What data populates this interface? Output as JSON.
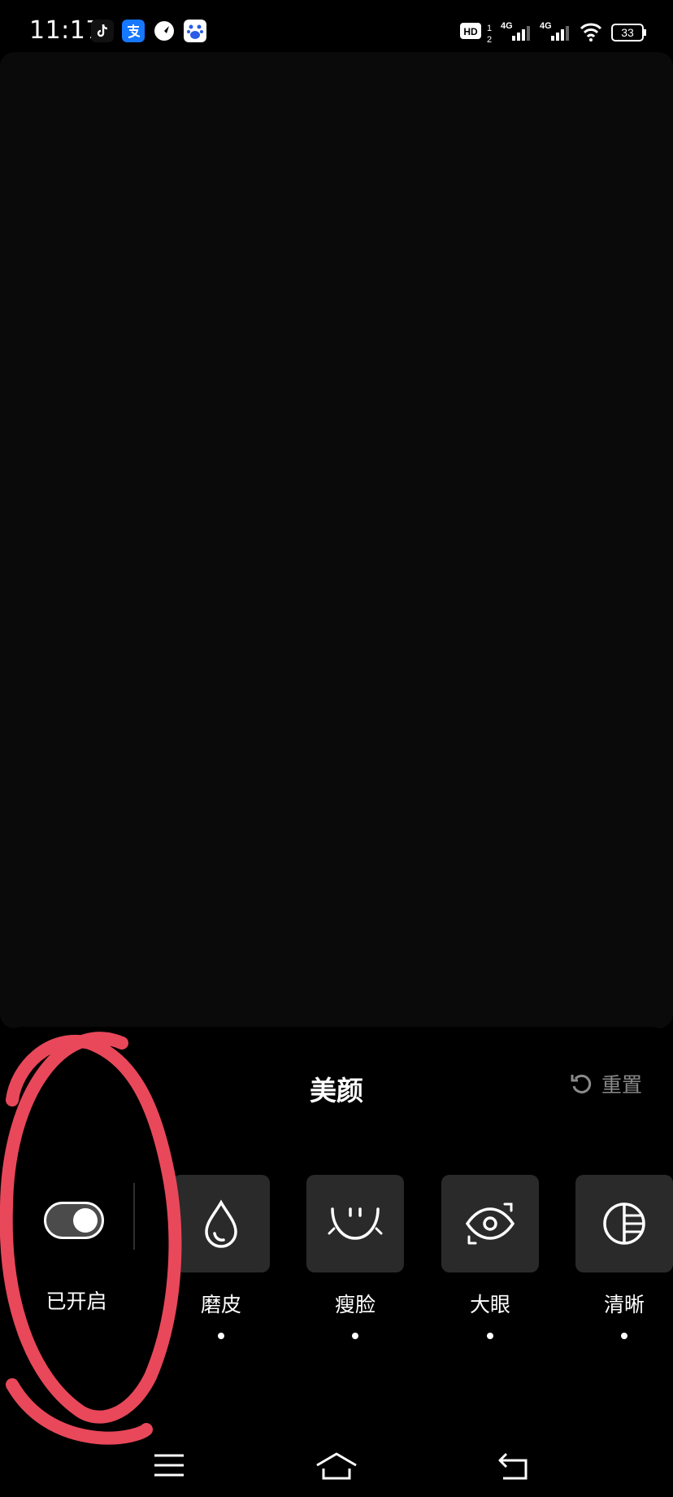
{
  "status_bar": {
    "time": "11:17",
    "app_icons": [
      "tiktok-icon",
      "alipay-icon",
      "compass-icon",
      "baidu-icon"
    ],
    "network_1": "4G",
    "network_2": "4G",
    "battery": "33",
    "hd_label": "HD"
  },
  "panel": {
    "title": "美颜",
    "reset_label": "重置",
    "toggle_label": "已开启",
    "toggle_on": true,
    "effects": [
      {
        "label": "磨皮",
        "icon": "drop-icon"
      },
      {
        "label": "瘦脸",
        "icon": "face-slim-icon"
      },
      {
        "label": "大眼",
        "icon": "eye-icon"
      },
      {
        "label": "清晰",
        "icon": "clarity-icon"
      }
    ]
  },
  "nav": {
    "icons": [
      "menu-icon",
      "home-icon",
      "back-icon"
    ]
  },
  "colors": {
    "background": "#000000",
    "tile": "#2a2a2a",
    "annotation": "#e8485a",
    "muted": "#8a8a8a"
  }
}
